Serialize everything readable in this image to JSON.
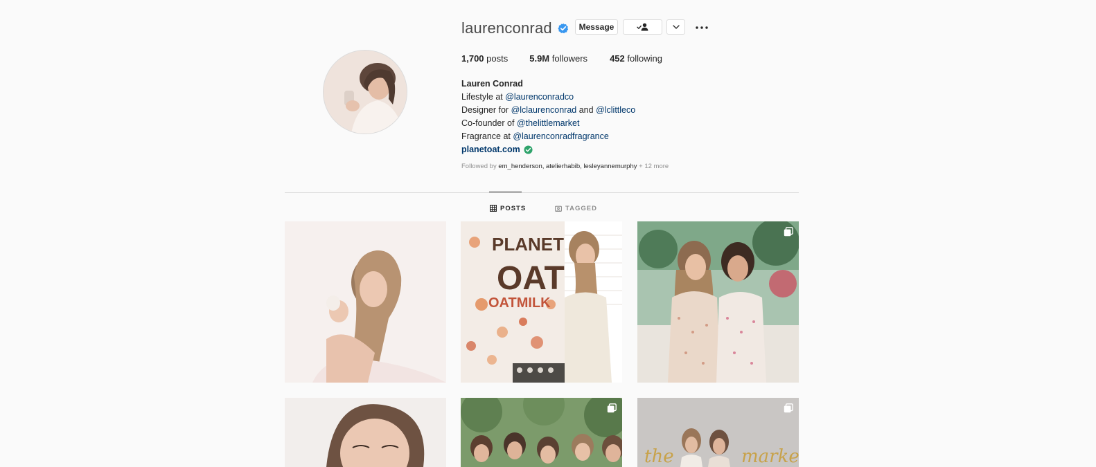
{
  "profile": {
    "username": "laurenconrad",
    "full_name": "Lauren Conrad",
    "stats": {
      "posts_num": "1,700",
      "posts_label": " posts",
      "followers_num": "5.9M",
      "followers_label": " followers",
      "following_num": "452",
      "following_label": " following"
    },
    "bio": [
      {
        "prefix": "Lifestyle at ",
        "mention": "@laurenconradco",
        "middle": "",
        "mention2": ""
      },
      {
        "prefix": "Designer for ",
        "mention": "@lclaurenconrad",
        "middle": " and ",
        "mention2": "@lclittleco"
      },
      {
        "prefix": "Co-founder of ",
        "mention": "@thelittlemarket",
        "middle": "",
        "mention2": ""
      },
      {
        "prefix": "Fragrance at ",
        "mention": "@laurenconradfragrance",
        "middle": "",
        "mention2": ""
      }
    ],
    "website": "planetoat.com",
    "followed_by": {
      "prefix": "Followed by ",
      "accounts": "em_henderson, atelierhabib, lesleyannemurphy",
      "suffix": " + 12 more"
    }
  },
  "actions": {
    "message_label": "Message"
  },
  "tabs": {
    "posts_label": "POSTS",
    "tagged_label": "TAGGED"
  },
  "posts": {
    "post2_text_line1": "PLANET",
    "post2_text_line2": "OAT",
    "post2_text_line3": "OATMILK",
    "post6_text": "the",
    "post6_text2": "marke"
  },
  "colors": {
    "background": "#fafafa",
    "text": "#262626",
    "mention": "#00376b",
    "muted": "#8e8e8e",
    "verified": "#3897f0",
    "link_badge": "#2fa36b",
    "border": "#dbdbdb"
  },
  "icons": {
    "verified": "verified-badge-icon",
    "follow_status": "user-check-icon",
    "dropdown": "chevron-down-icon",
    "more": "more-options-icon",
    "posts_tab": "grid-icon",
    "tagged_tab": "tagged-icon",
    "multi_post": "carousel-icon"
  }
}
